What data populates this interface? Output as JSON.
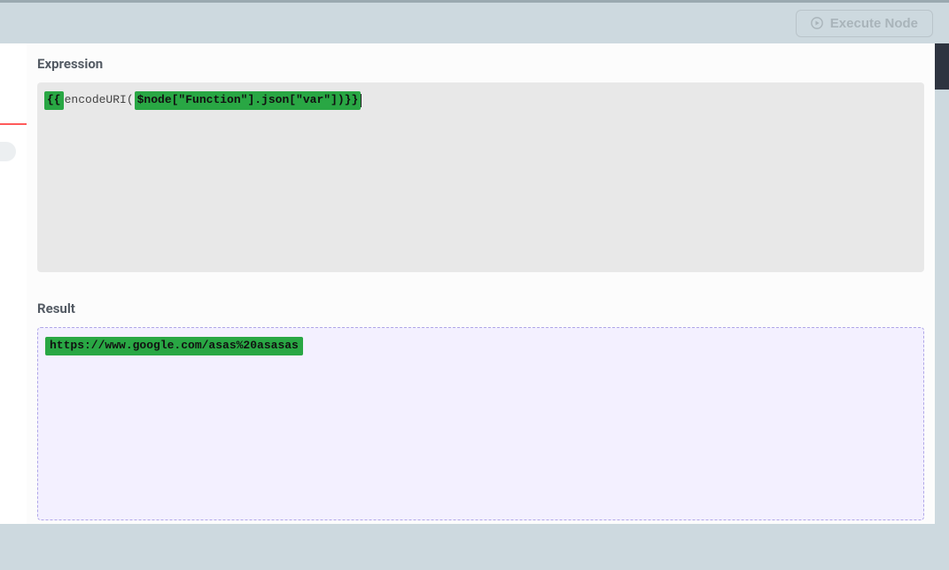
{
  "header": {
    "execute_label": "Execute Node"
  },
  "expression": {
    "label": "Expression",
    "tokens": {
      "open": "{{",
      "func": " encodeURI( ",
      "node": "$node[\"Function\"].json[\"var\"])}}"
    }
  },
  "result": {
    "label": "Result",
    "value": "https://www.google.com/asas%20asasas"
  }
}
